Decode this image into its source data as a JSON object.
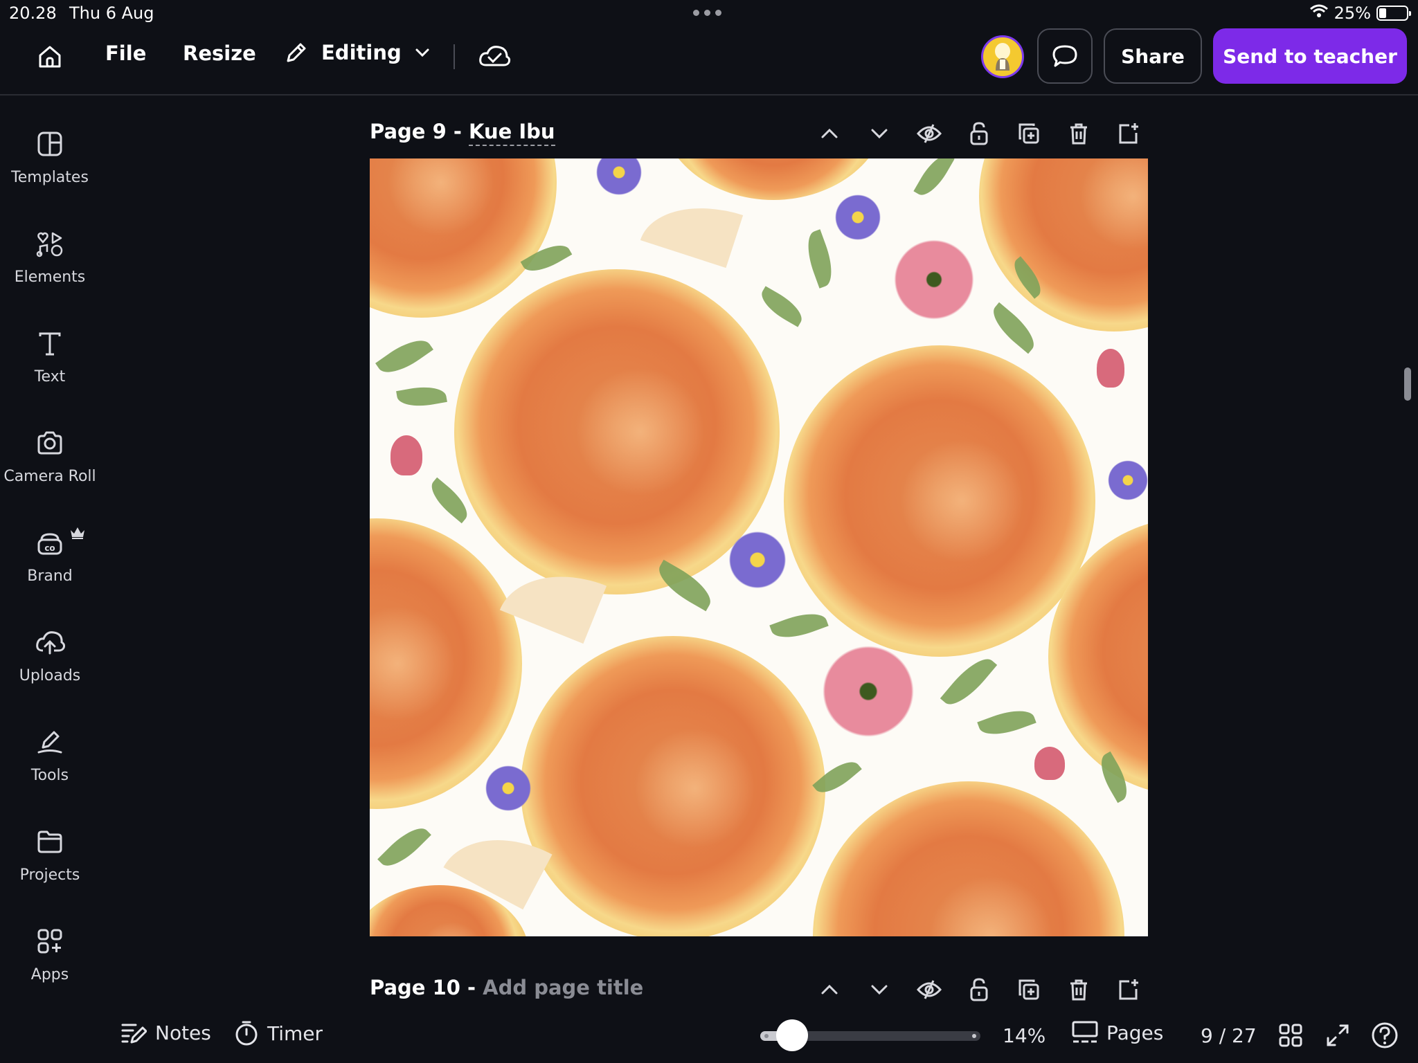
{
  "status_bar": {
    "time": "20.28",
    "date": "Thu 6 Aug",
    "battery_percent": "25%",
    "battery_level": 0.25
  },
  "toolbar": {
    "file_label": "File",
    "resize_label": "Resize",
    "editing_label": "Editing",
    "share_label": "Share",
    "send_label": "Send to teacher"
  },
  "sidebar": {
    "items": [
      {
        "label": "Templates",
        "icon": "templates-icon"
      },
      {
        "label": "Elements",
        "icon": "elements-icon"
      },
      {
        "label": "Text",
        "icon": "text-icon"
      },
      {
        "label": "Camera Roll",
        "icon": "camera-icon"
      },
      {
        "label": "Brand",
        "icon": "brand-icon"
      },
      {
        "label": "Uploads",
        "icon": "upload-cloud-icon"
      },
      {
        "label": "Tools",
        "icon": "tools-icon"
      },
      {
        "label": "Projects",
        "icon": "folder-icon"
      },
      {
        "label": "Apps",
        "icon": "apps-icon"
      }
    ]
  },
  "pages": {
    "current": {
      "prefix": "Page 9 - ",
      "title": "Kue Ibu"
    },
    "next": {
      "prefix": "Page 10 - ",
      "placeholder": "Add page title"
    }
  },
  "bottom_bar": {
    "notes_label": "Notes",
    "timer_label": "Timer",
    "zoom": "14%",
    "zoom_fraction": 0.14,
    "pages_label": "Pages",
    "page_count": "9 / 27"
  },
  "colors": {
    "accent": "#7d2ae8",
    "background": "#0e1016"
  }
}
